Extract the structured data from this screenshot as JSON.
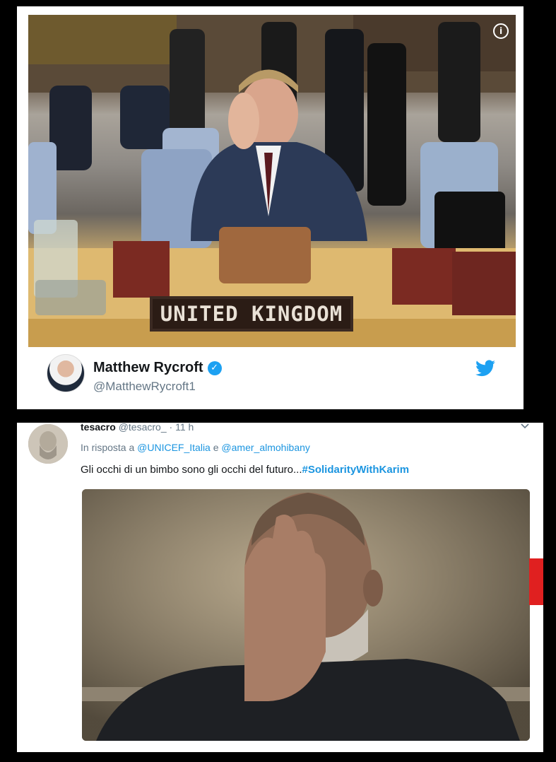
{
  "top_card": {
    "placard_text": "UNITED KINGDOM",
    "info_icon": "info-icon",
    "author_name": "Matthew Rycroft",
    "verified_icon": "verified-badge-icon",
    "author_handle": "@MatthewRycroft1",
    "brand_icon": "twitter-bird-icon"
  },
  "reply_tweet": {
    "name": "tesacro",
    "handle": "@tesacro_",
    "separator": "·",
    "time": "11 h",
    "reply_prefix": "In risposta a",
    "reply_user1": "@UNICEF_Italia",
    "reply_and": "e",
    "reply_user2": "@amer_almohibany",
    "text": "Gli occhi di un bimbo sono gli occhi del futuro...",
    "hashtag": "#SolidarityWithKarim",
    "menu_icon": "chevron-down-icon"
  },
  "colors": {
    "link": "#1b95e0",
    "verified": "#1da1f2",
    "side_red": "#e02020"
  }
}
